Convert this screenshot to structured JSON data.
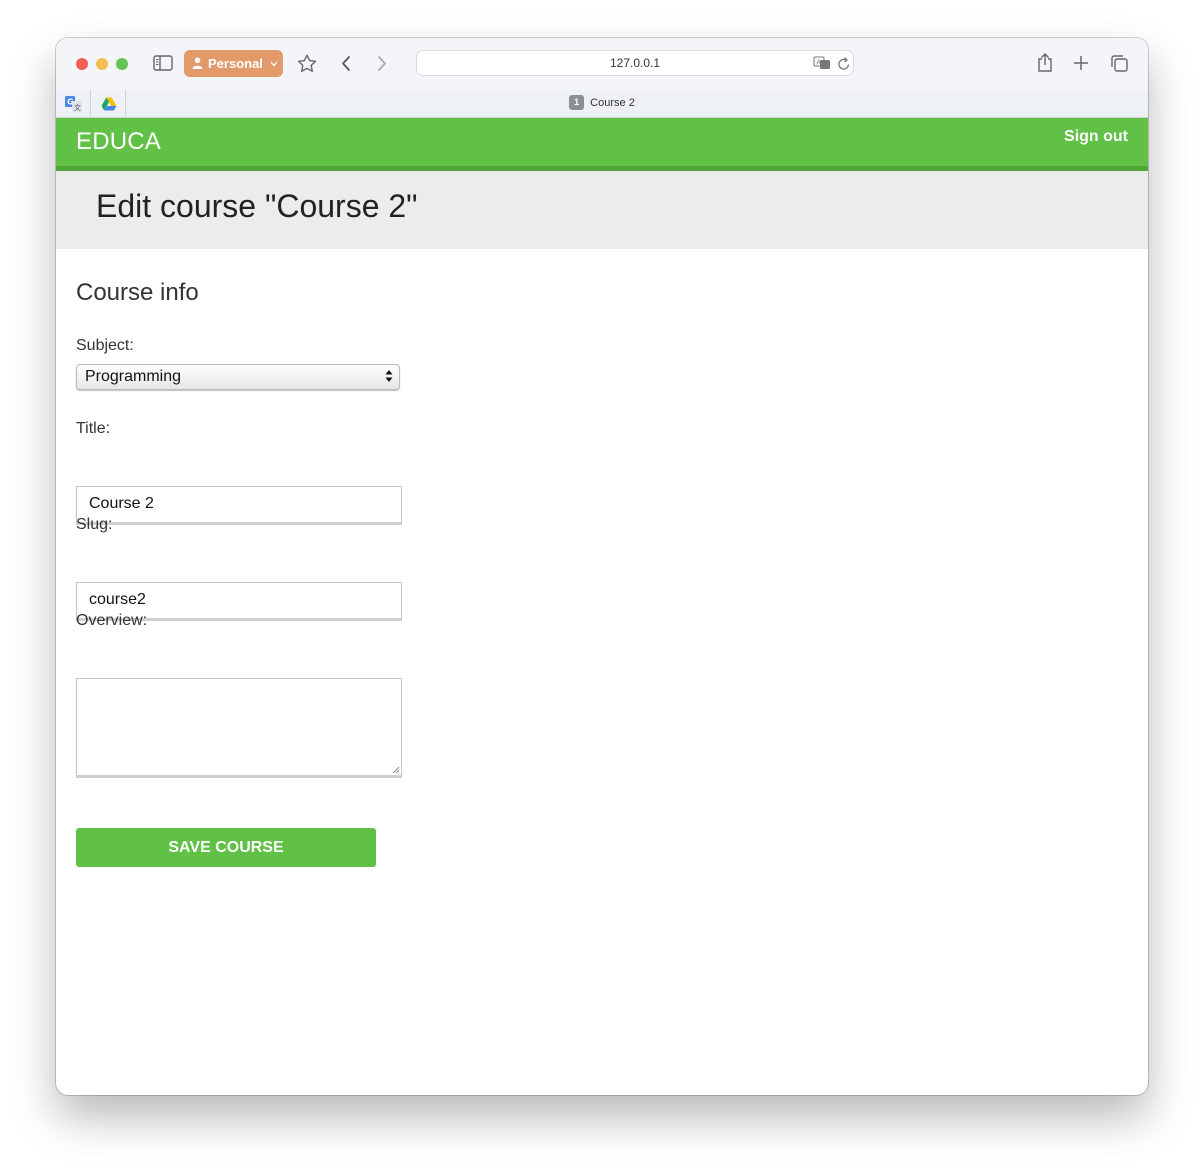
{
  "browser": {
    "profile_label": "Personal",
    "url": "127.0.0.1",
    "tab": {
      "number": "1",
      "title": "Course 2"
    },
    "icons": [
      "sidebar-icon",
      "star-icon",
      "back-icon",
      "forward-icon",
      "translate-icon",
      "reload-icon",
      "share-icon",
      "new-tab-icon",
      "tab-overview-icon",
      "google-translate-extension-icon",
      "google-drive-extension-icon"
    ]
  },
  "header": {
    "logo": "EDUCA",
    "signout_label": "Sign out",
    "colors": {
      "brand": "#61c046",
      "brand_dark": "#4ea535"
    }
  },
  "page": {
    "title": "Edit course \"Course 2\""
  },
  "form": {
    "section_title": "Course info",
    "subject": {
      "label": "Subject:",
      "value": "Programming"
    },
    "title": {
      "label": "Title:",
      "value": "Course 2"
    },
    "slug": {
      "label": "Slug:",
      "value": "course2"
    },
    "overview": {
      "label": "Overview:",
      "value": ""
    },
    "submit_label": "SAVE COURSE"
  }
}
